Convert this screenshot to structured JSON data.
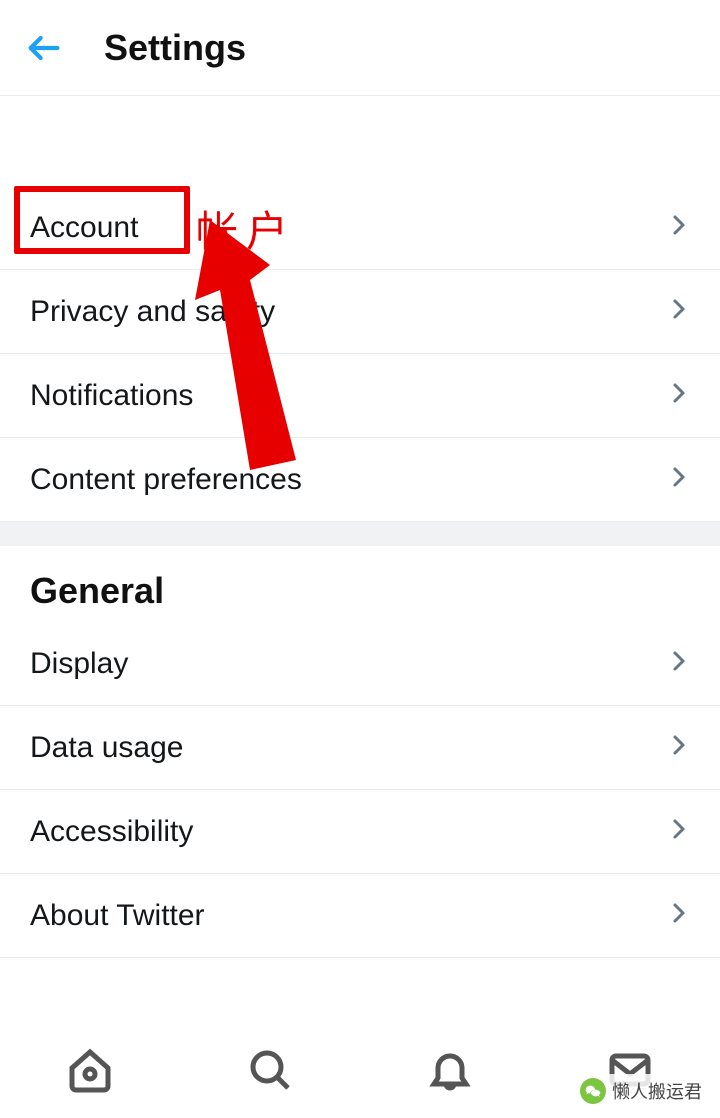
{
  "header": {
    "title": "Settings"
  },
  "annotations": {
    "label_zh": "帐户"
  },
  "sections": {
    "main": [
      {
        "label": "Account"
      },
      {
        "label": "Privacy and safety"
      },
      {
        "label": "Notifications"
      },
      {
        "label": "Content preferences"
      }
    ],
    "general_title": "General",
    "general": [
      {
        "label": "Display"
      },
      {
        "label": "Data usage"
      },
      {
        "label": "Accessibility"
      },
      {
        "label": "About Twitter"
      }
    ]
  },
  "watermark": {
    "text": "懒人搬运君"
  }
}
